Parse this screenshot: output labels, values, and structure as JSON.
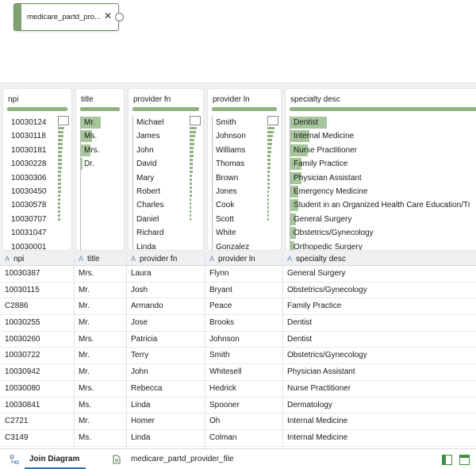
{
  "diagram": {
    "node_label": "medicare_partd_pro...",
    "close_symbol": "✕"
  },
  "profile": {
    "npi": {
      "header": "npi",
      "values": [
        "10030124",
        "10030118",
        "10030181",
        "10030228",
        "10030306",
        "10030450",
        "10030578",
        "10030707",
        "10031047",
        "10030001"
      ]
    },
    "title": {
      "header": "title",
      "values": [
        "Mr.",
        "Ms.",
        "Mrs.",
        "Dr."
      ],
      "fractions": [
        0.52,
        0.3,
        0.25,
        0.05
      ]
    },
    "provider_fn": {
      "header": "provider fn",
      "values": [
        "Michael",
        "James",
        "John",
        "David",
        "Mary",
        "Robert",
        "Charles",
        "Daniel",
        "Richard",
        "Linda"
      ]
    },
    "provider_ln": {
      "header": "provider ln",
      "values": [
        "Smith",
        "Johnson",
        "Williams",
        "Thomas",
        "Brown",
        "Jones",
        "Cook",
        "Scott",
        "White",
        "Gonzalez"
      ]
    },
    "specialty_desc": {
      "header": "specialty desc",
      "values": [
        "Dentist",
        "Internal Medicine",
        "Nurse Practitioner",
        "Family Practice",
        "Physician Assistant",
        "Emergency Medicine",
        "Student in an Organized Health Care Education/Tr",
        "General Surgery",
        "Obstetrics/Gynecology",
        "Orthopedic Surgery"
      ],
      "fractions": [
        0.19,
        0.1,
        0.09,
        0.06,
        0.06,
        0.04,
        0.04,
        0.03,
        0.03,
        0.02
      ]
    }
  },
  "columns": [
    {
      "label": "npi",
      "type_icon": "A"
    },
    {
      "label": "title",
      "type_icon": "A"
    },
    {
      "label": "provider fn",
      "type_icon": "A"
    },
    {
      "label": "provider ln",
      "type_icon": "A"
    },
    {
      "label": "specialty desc",
      "type_icon": "A"
    }
  ],
  "rows": [
    [
      "10030387",
      "Mrs.",
      "Laura",
      "Flynn",
      "General Surgery"
    ],
    [
      "10030115",
      "Mr.",
      "Josh",
      "Bryant",
      "Obstetrics/Gynecology"
    ],
    [
      "C2886",
      "Mr.",
      "Armando",
      "Peace",
      "Family Practice"
    ],
    [
      "10030255",
      "Mr.",
      "Jose",
      "Brooks",
      "Dentist"
    ],
    [
      "10030260",
      "Mrs.",
      "Patricia",
      "Johnson",
      "Dentist"
    ],
    [
      "10030722",
      "Mr.",
      "Terry",
      "Smith",
      "Obstetrics/Gynecology"
    ],
    [
      "10030942",
      "Mr.",
      "John",
      "Whitesell",
      "Physician Assistant"
    ],
    [
      "10030080",
      "Mrs.",
      "Rebecca",
      "Hedrick",
      "Nurse Practitioner"
    ],
    [
      "10030841",
      "Ms.",
      "Linda",
      "Spooner",
      "Dermatology"
    ],
    [
      "C2721",
      "Mr.",
      "Homer",
      "Oh",
      "Internal Medicine"
    ],
    [
      "C3149",
      "Ms.",
      "Linda",
      "Colman",
      "Internal Medicine"
    ]
  ],
  "tabs": {
    "join_diagram": "Join Diagram",
    "file": "medicare_partd_provider_file"
  },
  "icons": {
    "node": "dataset-node",
    "type": "string-type-icon",
    "join_diagram": "join-diagram-icon",
    "file": "file-icon",
    "view_toggle": [
      "split-view-icon",
      "panel-view-icon"
    ]
  },
  "colors": {
    "accent_green": "#7ea272",
    "bar_green": "#a7c59b",
    "active_tab": "#3a6fa5"
  }
}
